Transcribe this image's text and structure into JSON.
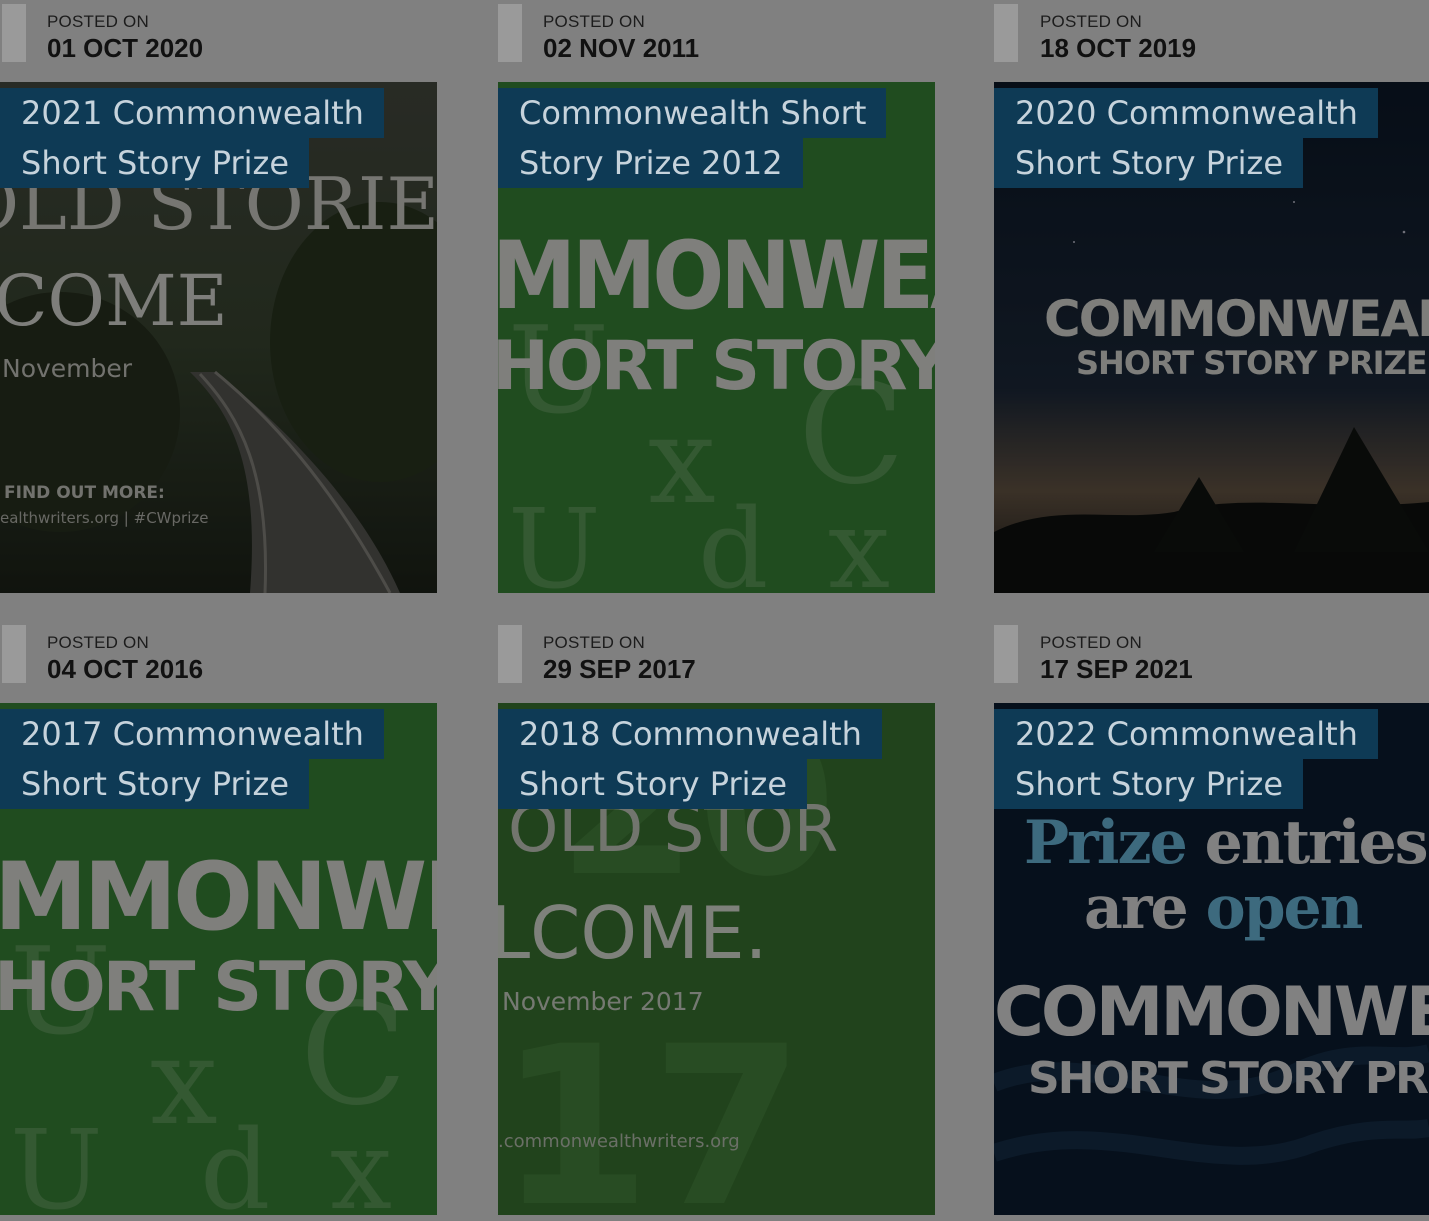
{
  "posts": [
    {
      "posted_label": "POSTED ON",
      "date": "01 OCT 2020",
      "title_lines": [
        "2021 Commonwealth",
        "Short Story Prize"
      ],
      "poster": {
        "big": "COME",
        "top": "OLD STORIES",
        "sub": "November",
        "cta": "FIND OUT MORE:",
        "url": "ealthwriters.org | #CWprize"
      }
    },
    {
      "posted_label": "POSTED ON",
      "date": "02 NOV 2011",
      "title_lines": [
        "Commonwealth Short",
        "Story Prize 2012"
      ],
      "poster": {
        "line1": "MMONWEAL",
        "line2": "HORT STORY PRI"
      }
    },
    {
      "posted_label": "POSTED ON",
      "date": "18 OCT 2019",
      "title_lines": [
        "2020 Commonwealth",
        "Short Story Prize"
      ],
      "poster": {
        "line1": "COMMONWEALTH",
        "line2": "SHORT STORY PRIZE"
      }
    },
    {
      "posted_label": "POSTED ON",
      "date": "04 OCT 2016",
      "title_lines": [
        "2017 Commonwealth",
        "Short Story Prize"
      ],
      "poster": {
        "line1": "MMONWEAL",
        "line2": "HORT STORY PRI"
      }
    },
    {
      "posted_label": "POSTED ON",
      "date": "29 SEP 2017",
      "title_lines": [
        "2018 Commonwealth",
        "Short Story Prize"
      ],
      "poster": {
        "top": "OLD STOR",
        "big": "LCOME.",
        "sub": "November 2017",
        "url": ".commonwealthwriters.org"
      }
    },
    {
      "posted_label": "POSTED ON",
      "date": "17 SEP 2021",
      "title_lines": [
        "2022 Commonwealth",
        "Short Story Prize"
      ],
      "poster": {
        "h1a": "Prize",
        "h1b": "entries",
        "h2a": "are",
        "h2b": "open",
        "line1": "COMMONWEALTH",
        "line2": "SHORT STORY PRIZE"
      }
    }
  ],
  "colors": {
    "page_bg": "#808080",
    "title_bg": "#0e3a55",
    "title_text": "#c6d3dc"
  }
}
